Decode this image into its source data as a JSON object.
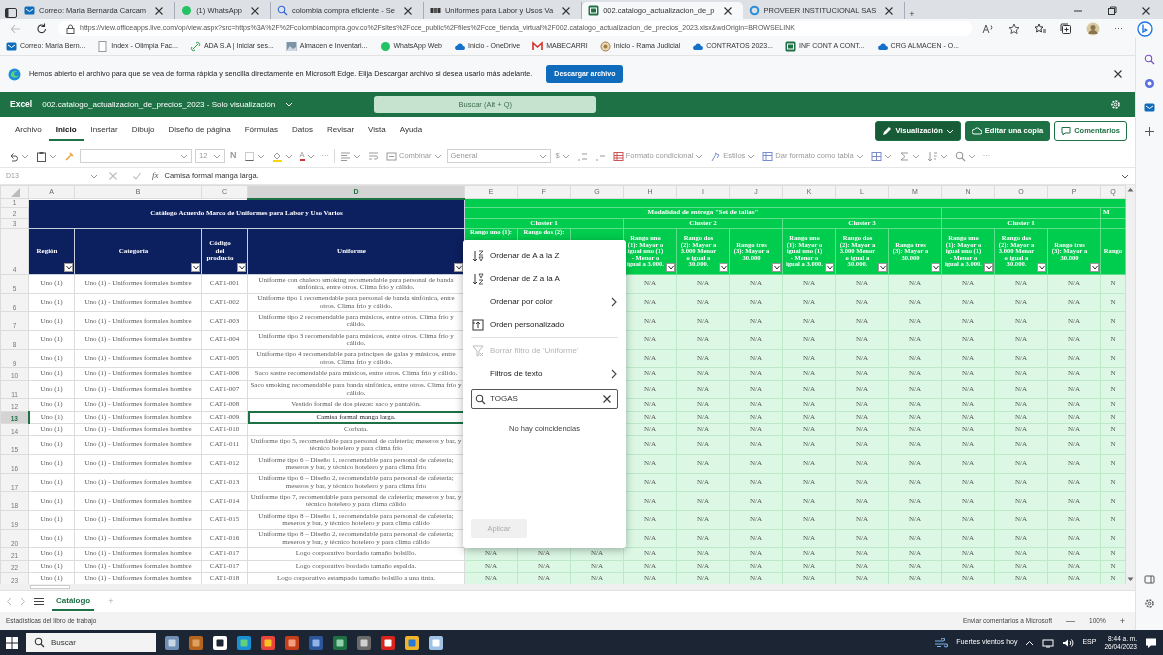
{
  "browser": {
    "tabs": [
      {
        "title": "Correo: Maria Bernarda Carcam",
        "selected": false
      },
      {
        "title": "(1) WhatsApp",
        "selected": false
      },
      {
        "title": "colombia compra eficiente - Se",
        "selected": false
      },
      {
        "title": "Uniformes para Labor y Usos Va",
        "selected": false
      },
      {
        "title": "002.catalogo_actualizacion_de_p",
        "selected": true
      },
      {
        "title": "PROVEER INSTITUCIONAL SAS",
        "selected": false
      }
    ],
    "new_tab": "+",
    "address": "https://view.officeapps.live.com/op/view.aspx?src=https%3A%2F%2Fcolombiacompra.gov.co%2Fsites%2Fcce_public%2Ffiles%2Fcce_tienda_virtual%2F002.catalogo_actualizacion_de_precios_2023.xlsx&wdOrigin=BROWSELINK",
    "more": "···",
    "bookmarks": [
      "Correo: Maria Bern...",
      "Index - Olimpia Fac...",
      "ADA S.A | Iniciar ses...",
      "Almacen e Inventari...",
      "WhatsApp Web",
      "Inicio - OneDrive",
      "MABECARRI",
      "Inicio - Rama Judicial",
      "CONTRATOS 2023...",
      "INF CONT A CONT...",
      "CRG ALMACEN - O..."
    ]
  },
  "infobar": {
    "message": "Hemos abierto el archivo para que se vea de forma rápida y sencilla directamente en Microsoft Edge. Elija Descargar archivo si desea usarlo más adelante.",
    "button": "Descargar archivo"
  },
  "excel": {
    "app": "Excel",
    "title": "002.catalogo_actualizacion_de_precios_2023  -  Solo visualización",
    "search_placeholder": "Buscar (Alt + Q)"
  },
  "ribbon": {
    "tabs": [
      {
        "label": "Archivo",
        "selected": false
      },
      {
        "label": "Inicio",
        "selected": true
      },
      {
        "label": "Insertar",
        "selected": false
      },
      {
        "label": "Dibujo",
        "selected": false
      },
      {
        "label": "Diseño de página",
        "selected": false
      },
      {
        "label": "Fórmulas",
        "selected": false
      },
      {
        "label": "Datos",
        "selected": false
      },
      {
        "label": "Revisar",
        "selected": false
      },
      {
        "label": "Vista",
        "selected": false
      },
      {
        "label": "Ayuda",
        "selected": false
      }
    ],
    "actions": [
      {
        "label": "Visualización",
        "kind": "dropdown"
      },
      {
        "label": "Editar una copia",
        "kind": "primary"
      },
      {
        "label": "Comentarios",
        "kind": "outline"
      }
    ]
  },
  "toolbar": {
    "font_size": "12",
    "bold": "N",
    "font_color": "A",
    "more": "···",
    "merge": "Combinar",
    "number_format": "General",
    "currency": "$",
    "conditional_format": "Formato condicional",
    "styles": "Estilos",
    "table_format": "Dar formato como tabla",
    "more_end": "···"
  },
  "formula_bar": {
    "cell": "D13",
    "fx": "fx",
    "content": "Camisa formal manga larga."
  },
  "sheet": {
    "columns": [
      {
        "label": "A",
        "selected": false
      },
      {
        "label": "B",
        "selected": false
      },
      {
        "label": "C",
        "selected": false
      },
      {
        "label": "D",
        "selected": true
      },
      {
        "label": "E",
        "selected": false
      },
      {
        "label": "F",
        "selected": false
      },
      {
        "label": "G",
        "selected": false
      },
      {
        "label": "H",
        "selected": false
      },
      {
        "label": "I",
        "selected": false
      },
      {
        "label": "J",
        "selected": false
      },
      {
        "label": "K",
        "selected": false
      },
      {
        "label": "L",
        "selected": false
      },
      {
        "label": "M",
        "selected": false
      },
      {
        "label": "N",
        "selected": false
      },
      {
        "label": "O",
        "selected": false
      },
      {
        "label": "P",
        "selected": false
      },
      {
        "label": "Q",
        "selected": false
      }
    ],
    "header_rows": [
      "1",
      "2",
      "3",
      "4"
    ],
    "title": "Catálogo Acuerdo Marco de Uniformes para Labor y Uso Varios",
    "group_title": "Modalidad de entrega \"Set de tallas\"",
    "next_group_title": "M",
    "clusters": [
      "Cluster 1",
      "Cluster 2",
      "Cluster 3",
      "Cluster 1"
    ],
    "headers": [
      "Región",
      "Categoría",
      "Código del producto",
      "Uniforme"
    ],
    "price_headers": [
      "Rango uno (1):",
      "Rango dos (2):",
      "Rango uno (1): Mayor o igual uno (1) - Menor o igual a 3.000.",
      "Rango dos (2): Mayor a 3.000 Menor o igual a 30.000.",
      "Rango tres (3): Mayor a 30.000",
      "Rango uno (1): Mayor o igual uno (1) - Menor o igual a 3.000.",
      "Rango dos (2): Mayor a 3.000 Menor o igual a 30.000.",
      "Rango tres (3): Mayor a 30.000",
      "Rango uno (1): Mayor o igual uno (1) - Menor o igual a 3.000.",
      "Rango dos (2): Mayor a 3.000 Menor o igual a 30.000.",
      "Rango tres (3): Mayor a 30.000",
      "Rango"
    ],
    "rows": [
      {
        "number": "5",
        "selected": false,
        "region": "Uno (1)",
        "category": "Uno (1) - Uniformes formales hombre",
        "code": "CAT1-001",
        "uniform": "Uniforme con chaleco smoking recomendable para personal de banda sinfónica, entre otros. Clima frío y cálido.",
        "values": [
          "N/A",
          "N/A",
          "N/A",
          "N/A",
          "N/A",
          "N/A",
          "N/A",
          "N/A",
          "N/A",
          "N"
        ]
      },
      {
        "number": "6",
        "selected": false,
        "region": "Uno (1)",
        "category": "Uno (1) - Uniformes formales hombre",
        "code": "CAT1-002",
        "uniform": "Uniforme tipo 1 recomendable para personal de banda sinfónica, entre otros. Clima frío y cálido.",
        "values": [
          "N/A",
          "N/A",
          "N/A",
          "N/A",
          "N/A",
          "N/A",
          "N/A",
          "N/A",
          "N/A",
          "N"
        ]
      },
      {
        "number": "7",
        "selected": false,
        "region": "Uno (1)",
        "category": "Uno (1) - Uniformes formales hombre",
        "code": "CAT1-003",
        "uniform": "Uniforme tipo 2 recomendable para músicos, entre otros. Clima frío y cálido.",
        "values": [
          "N/A",
          "N/A",
          "N/A",
          "N/A",
          "N/A",
          "N/A",
          "N/A",
          "N/A",
          "N/A",
          "N"
        ]
      },
      {
        "number": "8",
        "selected": false,
        "region": "Uno (1)",
        "category": "Uno (1) - Uniformes formales hombre",
        "code": "CAT1-004",
        "uniform": "Uniforme tipo 3 recomendable para músicos, entre otros. Clima frío y cálido.",
        "values": [
          "N/A",
          "N/A",
          "N/A",
          "N/A",
          "N/A",
          "N/A",
          "N/A",
          "N/A",
          "N/A",
          "N"
        ]
      },
      {
        "number": "9",
        "selected": false,
        "region": "Uno (1)",
        "category": "Uno (1) - Uniformes formales hombre",
        "code": "CAT1-005",
        "uniform": "Uniforme tipo 4 recomendable para príncipes de galas y músicos, entre otros. Clima frío y cálido.",
        "values": [
          "N/A",
          "N/A",
          "N/A",
          "N/A",
          "N/A",
          "N/A",
          "N/A",
          "N/A",
          "N/A",
          "N"
        ]
      },
      {
        "number": "10",
        "selected": false,
        "region": "Uno (1)",
        "category": "Uno (1) - Uniformes formales hombre",
        "code": "CAT1-006",
        "uniform": "Saco sastre recomendable para músicos, entre otros. Clima frío y cálido.",
        "values": [
          "N/A",
          "N/A",
          "N/A",
          "N/A",
          "N/A",
          "N/A",
          "N/A",
          "N/A",
          "N/A",
          "N"
        ]
      },
      {
        "number": "11",
        "selected": false,
        "region": "Uno (1)",
        "category": "Uno (1) - Uniformes formales hombre",
        "code": "CAT1-007",
        "uniform": "Saco smoking recomendable para banda sinfónica, entre otros. Clima frío y cálido.",
        "values": [
          "N/A",
          "N/A",
          "N/A",
          "N/A",
          "N/A",
          "N/A",
          "N/A",
          "N/A",
          "N/A",
          "N"
        ]
      },
      {
        "number": "12",
        "selected": false,
        "region": "Uno (1)",
        "category": "Uno (1) - Uniformes formales hombre",
        "code": "CAT1-008",
        "uniform": "Vestido formal de dos piezas: saco y pantalón.",
        "values": [
          "N/A",
          "N/A",
          "N/A",
          "N/A",
          "N/A",
          "N/A",
          "N/A",
          "N/A",
          "N/A",
          "N"
        ]
      },
      {
        "number": "13",
        "selected": true,
        "region": "Uno (1)",
        "category": "Uno (1) - Uniformes formales hombre",
        "code": "CAT1-009",
        "uniform": "Camisa formal manga larga.",
        "values": [
          "N/A",
          "N/A",
          "N/A",
          "N/A",
          "N/A",
          "N/A",
          "N/A",
          "N/A",
          "N/A",
          "N"
        ]
      },
      {
        "number": "14",
        "selected": false,
        "region": "Uno (1)",
        "category": "Uno (1) - Uniformes formales hombre",
        "code": "CAT1-010",
        "uniform": "Corbata.",
        "values": [
          "N/A",
          "N/A",
          "N/A",
          "N/A",
          "N/A",
          "N/A",
          "N/A",
          "N/A",
          "N/A",
          "N"
        ]
      },
      {
        "number": "15",
        "selected": false,
        "region": "Uno (1)",
        "category": "Uno (1) - Uniformes formales hombre",
        "code": "CAT1-011",
        "uniform": "Uniforme tipo 5, recomendable para personal de cafetería;  meseros y bar, y técnico hotelero y para clima frío",
        "values": [
          "N/A",
          "N/A",
          "N/A",
          "N/A",
          "N/A",
          "N/A",
          "N/A",
          "N/A",
          "N/A",
          "N"
        ]
      },
      {
        "number": "16",
        "selected": false,
        "region": "Uno (1)",
        "category": "Uno (1) - Uniformes formales hombre",
        "code": "CAT1-012",
        "uniform": "Uniforme tipo 6 – Diseño 1, recomendable para personal de cafetería;  meseros y bar, y técnico hotelero y para clima frío",
        "values": [
          "N/A",
          "N/A",
          "N/A",
          "N/A",
          "N/A",
          "N/A",
          "N/A",
          "N/A",
          "N/A",
          "N"
        ]
      },
      {
        "number": "17",
        "selected": false,
        "region": "Uno (1)",
        "category": "Uno (1) - Uniformes formales hombre",
        "code": "CAT1-013",
        "uniform": "Uniforme tipo 6 – Diseño 2, recomendable para personal de cafetería;  meseros y bar, y técnico hotelero y para clima frío",
        "values": [
          "N/A",
          "N/A",
          "N/A",
          "N/A",
          "N/A",
          "N/A",
          "N/A",
          "N/A",
          "N/A",
          "N"
        ]
      },
      {
        "number": "18",
        "selected": false,
        "region": "Uno (1)",
        "category": "Uno (1) - Uniformes formales hombre",
        "code": "CAT1-014",
        "uniform": "Uniforme tipo 7, recomendable para personal de cafetería;  meseros y bar, y técnico hotelero y para clima cálido",
        "values": [
          "N/A",
          "N/A",
          "N/A",
          "N/A",
          "N/A",
          "N/A",
          "N/A",
          "N/A",
          "N/A",
          "N"
        ]
      },
      {
        "number": "19",
        "selected": false,
        "region": "Uno (1)",
        "category": "Uno (1) - Uniformes formales hombre",
        "code": "CAT1-015",
        "uniform": "Uniforme tipo 8 – Diseño 1, recomendable para personal de cafetería;  meseros y bar, y técnico hotelero y para clima cálido",
        "values": [
          "N/A",
          "N/A",
          "N/A",
          "N/A",
          "N/A",
          "N/A",
          "N/A",
          "N/A",
          "N/A",
          "N"
        ]
      },
      {
        "number": "20",
        "selected": false,
        "region": "Uno (1)",
        "category": "Uno (1) - Uniformes formales hombre",
        "code": "CAT1-016",
        "uniform": "Uniforme tipo 8 – Diseño 2, recomendable para personal de cafetería;  meseros y bar, y técnico hotelero y para clima cálido",
        "values": [
          "N/A",
          "N/A",
          "N/A",
          "N/A",
          "N/A",
          "N/A",
          "N/A",
          "N/A",
          "N/A",
          "N"
        ]
      },
      {
        "number": "21",
        "selected": false,
        "region": "Uno (1)",
        "category": "Uno (1) - Uniformes formales hombre",
        "code": "CAT1-017",
        "uniform": "Logo corporativo bordado tamaño bolsillo.",
        "values": [
          "N/A",
          "N/A",
          "N/A",
          "N/A",
          "N/A",
          "N/A",
          "N/A",
          "N/A",
          "N/A",
          "N/A",
          "N/A",
          "N/A",
          "N"
        ]
      },
      {
        "number": "22",
        "selected": false,
        "region": "Uno (1)",
        "category": "Uno (1) - Uniformes formales hombre",
        "code": "CAT1-017",
        "uniform": "Logo corporativo bordado tamaño espalda.",
        "values": [
          "N/A",
          "N/A",
          "N/A",
          "N/A",
          "N/A",
          "N/A",
          "N/A",
          "N/A",
          "N/A",
          "N/A",
          "N/A",
          "N/A",
          "N"
        ]
      },
      {
        "number": "23",
        "selected": false,
        "region": "Uno (1)",
        "category": "Uno (1) - Uniformes formales hombre",
        "code": "CAT1-018",
        "uniform": "Logo corporativo estampado tamaño bolsillo a una tinta.",
        "values": [
          "N/A",
          "N/A",
          "N/A",
          "N/A",
          "N/A",
          "N/A",
          "N/A",
          "N/A",
          "N/A",
          "N/A",
          "N/A",
          "N/A",
          "N"
        ]
      }
    ]
  },
  "filter_menu": {
    "items": [
      {
        "label": "Ordenar de A a la Z",
        "kind": "action",
        "disabled": false
      },
      {
        "label": "Ordenar de Z a la A",
        "kind": "action",
        "disabled": false
      },
      {
        "label": "Ordenar por color",
        "kind": "submenu",
        "disabled": false
      },
      {
        "label": "Orden personalizado",
        "kind": "action",
        "disabled": false
      },
      {
        "label": "Borrar filtro de 'Uniforme'",
        "kind": "action",
        "disabled": true
      },
      {
        "label": "Filtros de texto",
        "kind": "submenu",
        "disabled": false
      }
    ],
    "search_value": "TOGAS",
    "message": "No hay coincidencias",
    "apply": {
      "label": "Aplicar",
      "disabled": true
    }
  },
  "sheet_tabs": [
    {
      "label": "Catálogo",
      "selected": true
    }
  ],
  "add_sheet": "+",
  "status_bar": {
    "left": "Estadísticas del libro de trabajo",
    "feedback": "Enviar comentarios a Microsoft",
    "zoom_out": "—",
    "zoom": "100%",
    "zoom_in": "+"
  },
  "taskbar": {
    "search": "Buscar",
    "weather": "Fuertes vientos hoy",
    "language": "ESP",
    "time": "8:44 a. m.",
    "date": "26/04/2023"
  }
}
